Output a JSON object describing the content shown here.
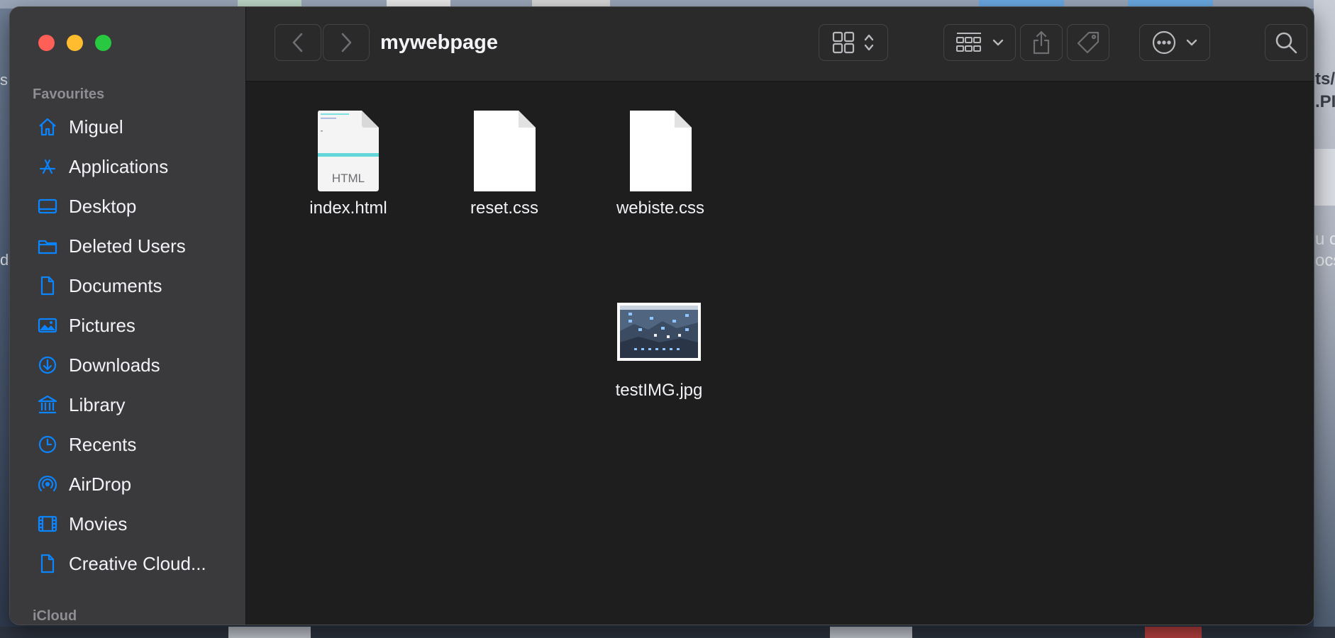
{
  "window": {
    "title": "mywebpage"
  },
  "sidebar": {
    "favourites_title": "Favourites",
    "icloud_title": "iCloud",
    "items": [
      {
        "label": "Miguel",
        "icon": "home-icon"
      },
      {
        "label": "Applications",
        "icon": "applications-icon"
      },
      {
        "label": "Desktop",
        "icon": "desktop-icon"
      },
      {
        "label": "Deleted Users",
        "icon": "folder-icon"
      },
      {
        "label": "Documents",
        "icon": "document-icon"
      },
      {
        "label": "Pictures",
        "icon": "pictures-icon"
      },
      {
        "label": "Downloads",
        "icon": "download-icon"
      },
      {
        "label": "Library",
        "icon": "library-icon"
      },
      {
        "label": "Recents",
        "icon": "clock-icon"
      },
      {
        "label": "AirDrop",
        "icon": "airdrop-icon"
      },
      {
        "label": "Movies",
        "icon": "film-icon"
      },
      {
        "label": "Creative Cloud...",
        "icon": "document-icon"
      }
    ]
  },
  "files": [
    {
      "name": "index.html",
      "kind": "html",
      "badge": "HTML"
    },
    {
      "name": "reset.css",
      "kind": "css"
    },
    {
      "name": "webiste.css",
      "kind": "css"
    },
    {
      "name": "testIMG.jpg",
      "kind": "image"
    }
  ],
  "colors": {
    "accent": "#0a84ff",
    "close": "#ff5f57",
    "minimize": "#febc2e",
    "maximize": "#28c840",
    "sidebar_bg": "#3a3a3c",
    "content_bg": "#1e1e1e"
  }
}
